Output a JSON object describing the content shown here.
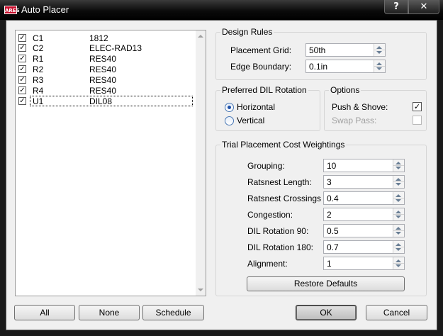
{
  "window": {
    "title": "Auto Placer",
    "app_icon": "ARES",
    "help_label": "?",
    "close_label": "✕"
  },
  "components": [
    {
      "ref": "C1",
      "value": "1812",
      "checked": true
    },
    {
      "ref": "C2",
      "value": "ELEC-RAD13",
      "checked": true
    },
    {
      "ref": "R1",
      "value": "RES40",
      "checked": true
    },
    {
      "ref": "R2",
      "value": "RES40",
      "checked": true
    },
    {
      "ref": "R3",
      "value": "RES40",
      "checked": true
    },
    {
      "ref": "R4",
      "value": "RES40",
      "checked": true
    },
    {
      "ref": "U1",
      "value": "DIL08",
      "checked": true
    }
  ],
  "check_mark": "✓",
  "list_buttons": {
    "all": "All",
    "none": "None",
    "schedule": "Schedule"
  },
  "design_rules": {
    "title": "Design Rules",
    "placement_grid_label": "Placement Grid:",
    "placement_grid_value": "50th",
    "edge_boundary_label": "Edge Boundary:",
    "edge_boundary_value": "0.1in"
  },
  "dil_rotation": {
    "title": "Preferred DIL Rotation",
    "horizontal_label": "Horizontal",
    "vertical_label": "Vertical",
    "selected": "Horizontal"
  },
  "options": {
    "title": "Options",
    "push_shove_label": "Push & Shove:",
    "push_shove_checked": true,
    "swap_pass_label": "Swap Pass:",
    "swap_pass_checked": false
  },
  "weightings": {
    "title": "Trial Placement Cost Weightings",
    "rows": [
      {
        "label": "Grouping:",
        "value": "10"
      },
      {
        "label": "Ratsnest Length:",
        "value": "3"
      },
      {
        "label": "Ratsnest Crossings",
        "value": "0.4"
      },
      {
        "label": "Congestion:",
        "value": "2"
      },
      {
        "label": "DIL Rotation 90:",
        "value": "0.5"
      },
      {
        "label": "DIL Rotation 180:",
        "value": "0.7"
      },
      {
        "label": "Alignment:",
        "value": "1"
      }
    ],
    "restore_label": "Restore Defaults"
  },
  "dialog_buttons": {
    "ok": "OK",
    "cancel": "Cancel"
  }
}
